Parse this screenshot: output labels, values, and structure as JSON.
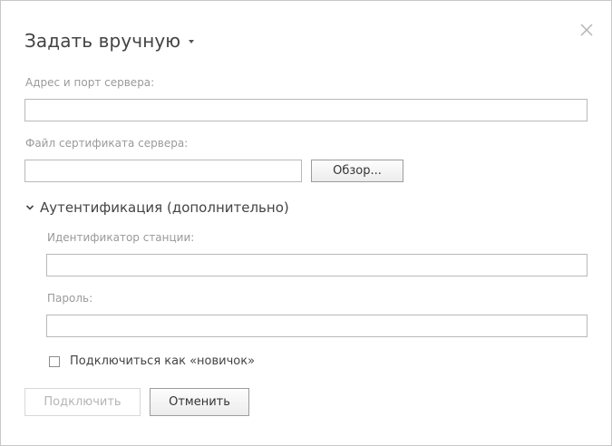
{
  "dialog": {
    "title": "Задать вручную",
    "close_icon": "close-icon",
    "title_caret_icon": "caret-down-icon"
  },
  "fields": {
    "server_address": {
      "label": "Адрес и порт сервера:",
      "value": ""
    },
    "certificate_file": {
      "label": "Файл сертификата сервера:",
      "value": "",
      "browse_label": "Обзор..."
    }
  },
  "auth_section": {
    "title": "Аутентификация (дополнительно)",
    "expanded": true,
    "chevron_icon": "chevron-down-icon",
    "station_id": {
      "label": "Идентификатор станции:",
      "value": ""
    },
    "password": {
      "label": "Пароль:",
      "value": ""
    },
    "newbie_checkbox": {
      "label": "Подключиться как «новичок»",
      "checked": false
    }
  },
  "actions": {
    "connect_label": "Подключить",
    "connect_disabled": true,
    "cancel_label": "Отменить"
  }
}
